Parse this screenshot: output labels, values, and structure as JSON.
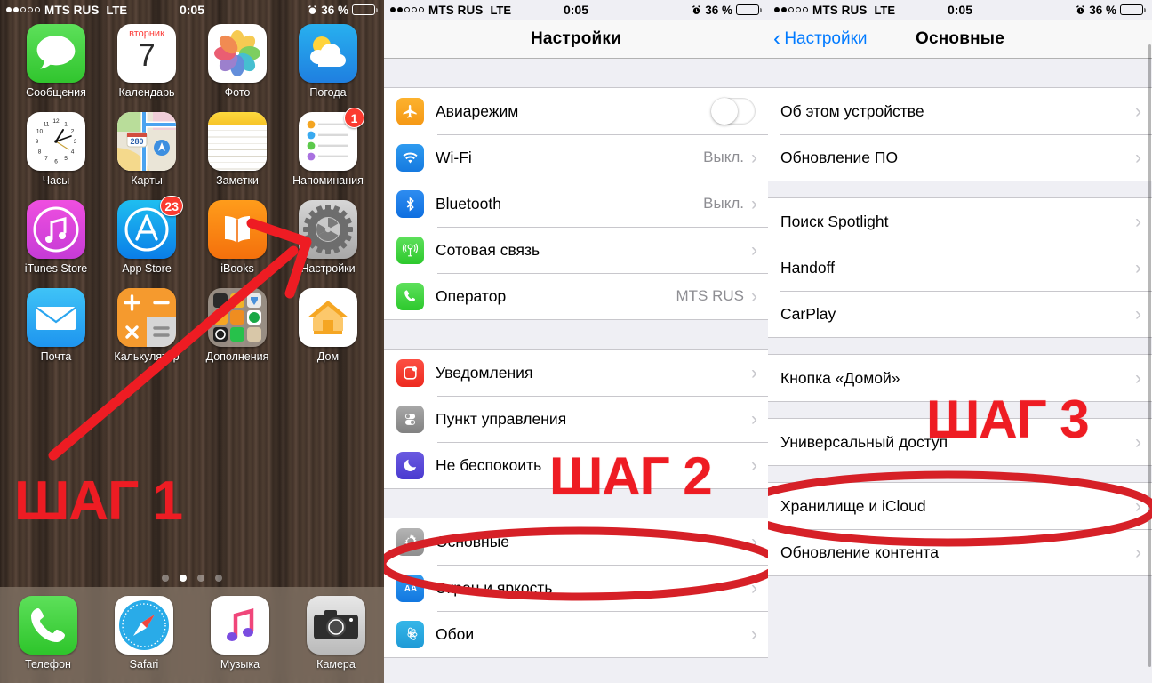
{
  "status_bar": {
    "signal_dots_filled": 2,
    "signal_dots_total": 5,
    "carrier": "MTS RUS",
    "network": "LTE",
    "time": "0:05",
    "battery_percent": "36 %",
    "battery_level": 0.36,
    "alarm_icon": "alarm-clock-icon"
  },
  "home_screen": {
    "apps": [
      {
        "label": "Сообщения",
        "icon": "messages-icon"
      },
      {
        "label": "Календарь",
        "icon": "calendar-icon",
        "weekday": "вторник",
        "day": "7"
      },
      {
        "label": "Фото",
        "icon": "photos-icon"
      },
      {
        "label": "Погода",
        "icon": "weather-icon"
      },
      {
        "label": "Часы",
        "icon": "clock-icon"
      },
      {
        "label": "Карты",
        "icon": "maps-icon",
        "road": "280"
      },
      {
        "label": "Заметки",
        "icon": "notes-icon"
      },
      {
        "label": "Напоминания",
        "icon": "reminders-icon",
        "badge": "1"
      },
      {
        "label": "iTunes Store",
        "icon": "itunes-store-icon"
      },
      {
        "label": "App Store",
        "icon": "app-store-icon",
        "badge": "23"
      },
      {
        "label": "iBooks",
        "icon": "ibooks-icon"
      },
      {
        "label": "Настройки",
        "icon": "settings-gear-icon"
      },
      {
        "label": "Почта",
        "icon": "mail-icon"
      },
      {
        "label": "Калькулятор",
        "icon": "calculator-icon"
      },
      {
        "label": "Дополнения",
        "icon": "extras-folder-icon"
      },
      {
        "label": "Дом",
        "icon": "home-app-icon"
      }
    ],
    "page_dots": {
      "count": 4,
      "active_index": 1
    },
    "dock": [
      {
        "label": "Телефон",
        "icon": "phone-icon"
      },
      {
        "label": "Safari",
        "icon": "safari-compass-icon"
      },
      {
        "label": "Музыка",
        "icon": "music-note-icon"
      },
      {
        "label": "Камера",
        "icon": "camera-icon"
      }
    ]
  },
  "settings_screen": {
    "title": "Настройки",
    "groups": [
      {
        "rows": [
          {
            "label": "Авиарежим",
            "icon": "airplane-icon",
            "control": "toggle",
            "toggle_on": false
          },
          {
            "label": "Wi-Fi",
            "icon": "wifi-icon",
            "value": "Выкл.",
            "chevron": true
          },
          {
            "label": "Bluetooth",
            "icon": "bluetooth-icon",
            "value": "Выкл.",
            "chevron": true
          },
          {
            "label": "Сотовая связь",
            "icon": "cellular-icon",
            "value": "",
            "chevron": true
          },
          {
            "label": "Оператор",
            "icon": "carrier-phone-icon",
            "value": "MTS RUS",
            "chevron": true
          }
        ]
      },
      {
        "rows": [
          {
            "label": "Уведомления",
            "icon": "notifications-icon",
            "value": "",
            "chevron": true
          },
          {
            "label": "Пункт управления",
            "icon": "control-center-icon",
            "value": "",
            "chevron": true
          },
          {
            "label": "Не беспокоить",
            "icon": "do-not-disturb-icon",
            "value": "",
            "chevron": true
          }
        ]
      },
      {
        "rows": [
          {
            "label": "Основные",
            "icon": "general-gear-icon",
            "value": "",
            "chevron": true
          },
          {
            "label": "Экран и яркость",
            "icon": "display-aa-icon",
            "value": "",
            "chevron": true
          },
          {
            "label": "Обои",
            "icon": "wallpaper-icon",
            "value": "",
            "chevron": true
          }
        ]
      }
    ]
  },
  "general_screen": {
    "back_label": "Настройки",
    "title": "Основные",
    "groups": [
      {
        "rows": [
          {
            "label": "Об этом устройстве",
            "chevron": true
          },
          {
            "label": "Обновление ПО",
            "chevron": true
          }
        ]
      },
      {
        "rows": [
          {
            "label": "Поиск Spotlight",
            "chevron": true
          },
          {
            "label": "Handoff",
            "chevron": true
          },
          {
            "label": "CarPlay",
            "chevron": true
          }
        ]
      },
      {
        "rows": [
          {
            "label": "Кнопка «Домой»",
            "chevron": true
          },
          {
            "label": "Универсальный доступ",
            "chevron": true
          }
        ]
      },
      {
        "rows": [
          {
            "label": "Хранилище и iCloud",
            "chevron": true
          },
          {
            "label": "Обновление контента",
            "chevron": true
          }
        ]
      }
    ]
  },
  "annotations": {
    "accent_color": "#ee1c23",
    "step1": "ШАГ 1",
    "step2": "ШАГ 2",
    "step3": "ШАГ 3"
  }
}
